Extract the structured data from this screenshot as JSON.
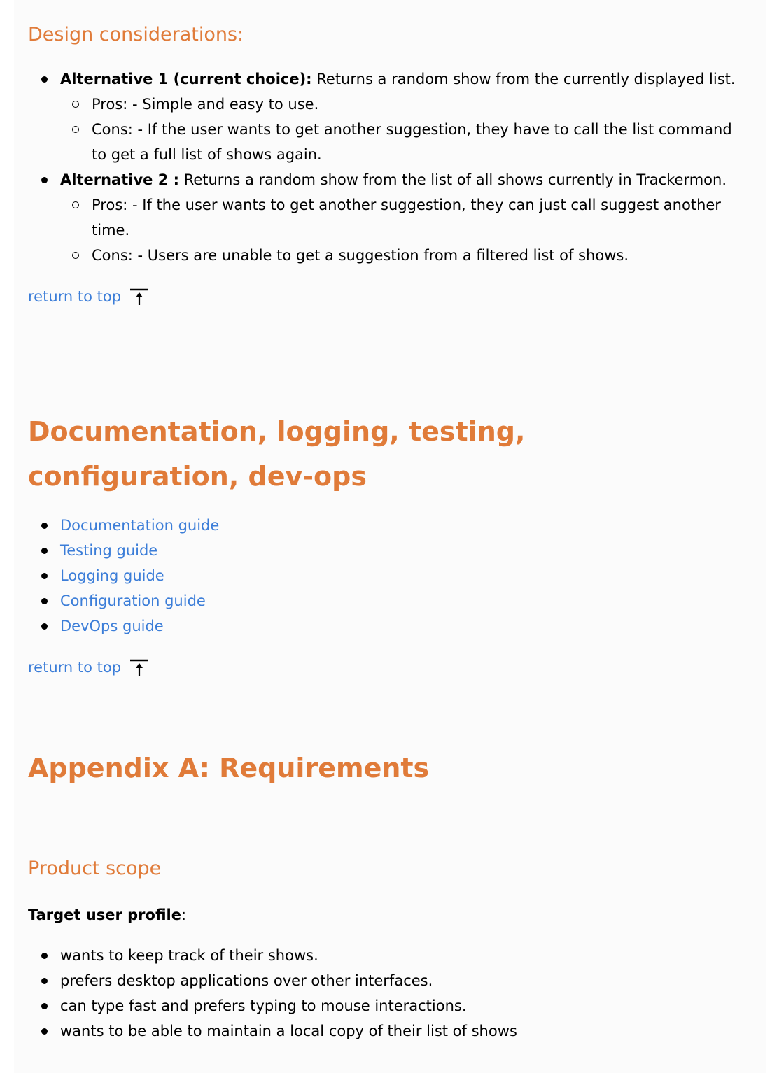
{
  "design": {
    "heading": "Design considerations:",
    "alternatives": [
      {
        "title": "Alternative 1 (current choice):",
        "text": " Returns a random show from the currently displayed list.",
        "pros": "Pros: - Simple and easy to use.",
        "cons": "Cons: - If the user wants to get another suggestion, they have to call the list command to get a full list of shows again."
      },
      {
        "title": "Alternative 2 :",
        "text": " Returns a random show from the list of all shows currently in Trackermon.",
        "pros": "Pros: - If the user wants to get another suggestion, they can just call suggest another time.",
        "cons": "Cons: - Users are unable to get a suggestion from a filtered list of shows."
      }
    ]
  },
  "return_to_top": "return to top",
  "docs": {
    "heading": "Documentation, logging, testing, configuration, dev-ops",
    "links": [
      "Documentation guide",
      "Testing guide",
      "Logging guide",
      "Configuration guide",
      "DevOps guide"
    ]
  },
  "appendix": {
    "heading": "Appendix A: Requirements",
    "product_scope": "Product scope",
    "target_label": "Target user profile",
    "target_suffix": ":",
    "profile": [
      "wants to keep track of their shows.",
      "prefers desktop applications over other interfaces.",
      "can type fast and prefers typing to mouse interactions.",
      "wants to be able to maintain a local copy of their list of shows"
    ]
  }
}
